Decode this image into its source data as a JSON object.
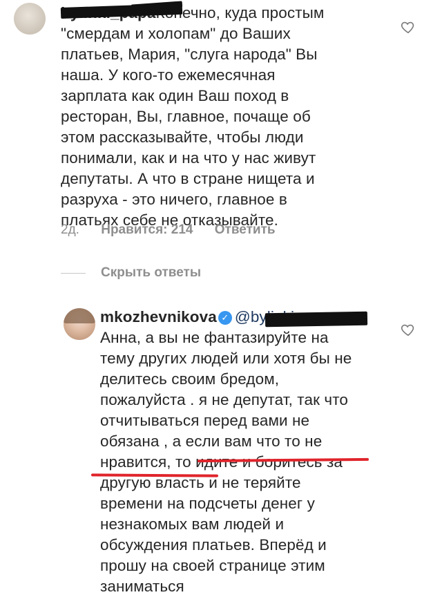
{
  "comment1": {
    "username": "bylinki_papa",
    "text": "Конечно, куда простым\n\"смердам и холопам\" до Ваших\nплатьев, Мария, \"слуга народа\" Вы\nнаша. У кого-то ежемесячная\nзарплата как один Ваш поход в\nресторан, Вы, главное, почаще об\nэтом рассказывайте, чтобы люди\nпонимали, как и на что у нас живут\nдепутаты. А что в стране нищета и\nразруха - это ничего, главное в\nплатьях себе не отказывайте.",
    "time": "2д.",
    "likes": "Нравится: 214",
    "reply": "Ответить"
  },
  "hide_replies": "Скрыть ответы",
  "comment2": {
    "username": "mkozhevnikova",
    "mention": "@bylinki_papa",
    "text_before_underline": "Анна, а вы не фантазируйте на\nтему других людей или хотя бы не\nделитесь своим бредом,\nпожалуйста . я не депутат, так что\nотчитываться перед вами не\nобязана , а если вам что то не\nнравится, то ",
    "text_underlined": "идите и боритесь за\nдругую власть",
    "text_after_underline": " и не теряйте\nвремени на подсчеты денег  у\nнезнакомых вам людей и\nобсуждения платьев. Вперёд и\nпрошу на своей странице этим\nзаниматься"
  },
  "colors": {
    "text": "#262626",
    "meta": "#8e8e8e",
    "verified": "#3897f0",
    "underline": "#e0242b"
  },
  "icons": [
    "heart-icon",
    "verified-badge-icon"
  ]
}
